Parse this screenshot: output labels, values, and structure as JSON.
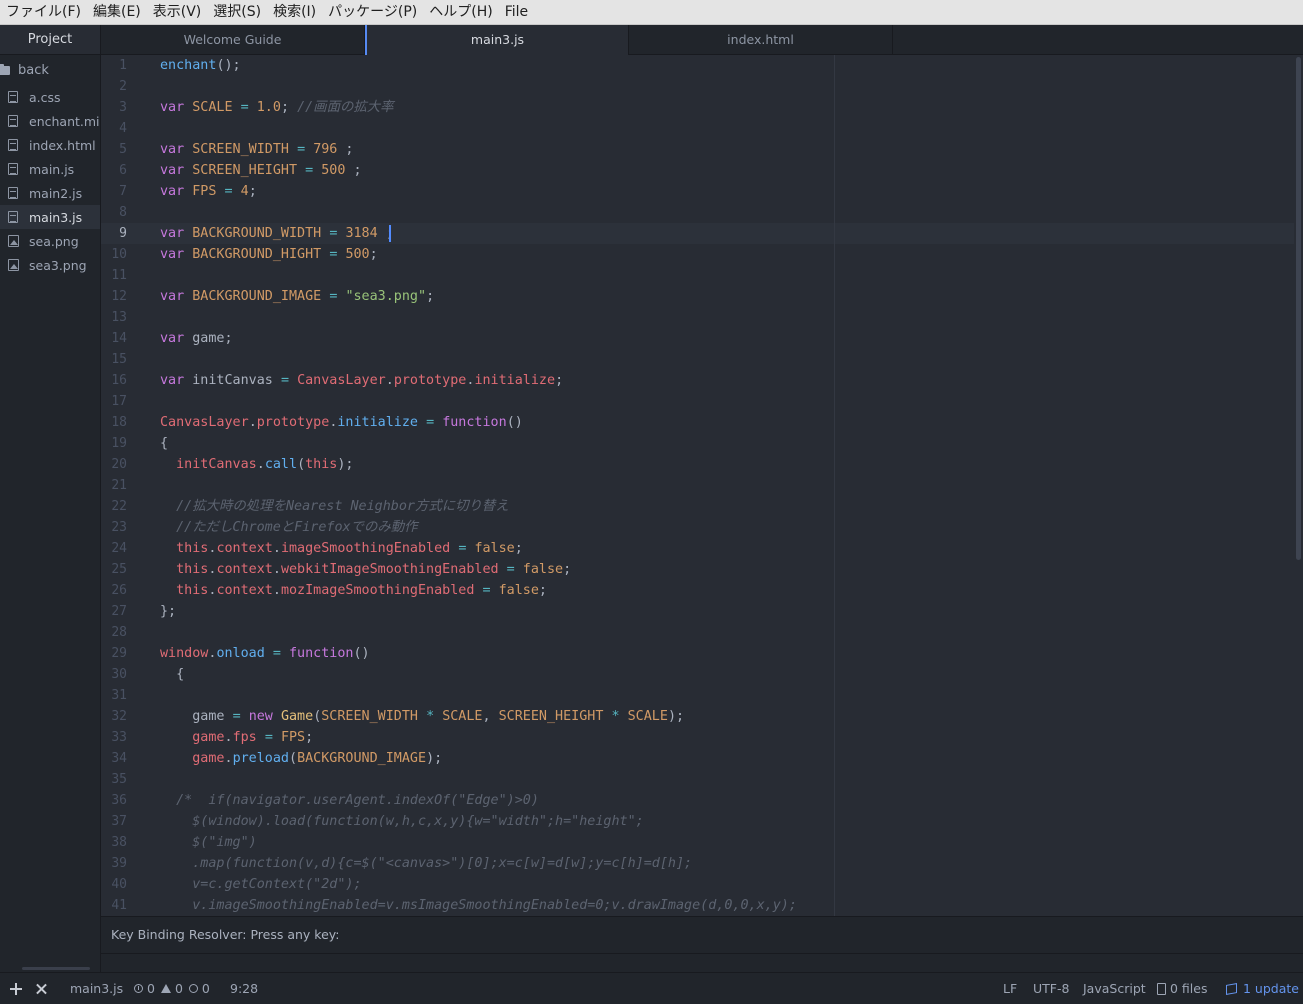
{
  "menubar": {
    "items": [
      "ファイル(F)",
      "編集(E)",
      "表示(V)",
      "選択(S)",
      "検索(I)",
      "パッケージ(P)",
      "ヘルプ(H)",
      "File"
    ]
  },
  "treeview": {
    "tab_label": "Project",
    "root_folder": "back",
    "files": [
      {
        "name": "a.css",
        "type": "file"
      },
      {
        "name": "enchant.min.js",
        "type": "file"
      },
      {
        "name": "index.html",
        "type": "file"
      },
      {
        "name": "main.js",
        "type": "file"
      },
      {
        "name": "main2.js",
        "type": "file"
      },
      {
        "name": "main3.js",
        "type": "file",
        "selected": true
      },
      {
        "name": "sea.png",
        "type": "image"
      },
      {
        "name": "sea3.png",
        "type": "image"
      }
    ]
  },
  "tabs": [
    {
      "label": "Welcome Guide",
      "active": false
    },
    {
      "label": "main3.js",
      "active": true
    },
    {
      "label": "index.html",
      "active": false
    }
  ],
  "editor": {
    "cursor_line": 9,
    "lines": [
      [
        [
          "f",
          "enchant"
        ],
        [
          "p",
          "();"
        ]
      ],
      [],
      [
        [
          "k",
          "var"
        ],
        [
          "p",
          " "
        ],
        [
          "c",
          "SCALE"
        ],
        [
          "p",
          " "
        ],
        [
          "o",
          "="
        ],
        [
          "p",
          " "
        ],
        [
          "n",
          "1.0"
        ],
        [
          "p",
          "; "
        ],
        [
          "cm",
          "//画面の拡大率"
        ]
      ],
      [],
      [
        [
          "k",
          "var"
        ],
        [
          "p",
          " "
        ],
        [
          "c",
          "SCREEN_WIDTH"
        ],
        [
          "p",
          " "
        ],
        [
          "o",
          "="
        ],
        [
          "p",
          " "
        ],
        [
          "n",
          "796"
        ],
        [
          "p",
          " ;"
        ]
      ],
      [
        [
          "k",
          "var"
        ],
        [
          "p",
          " "
        ],
        [
          "c",
          "SCREEN_HEIGHT"
        ],
        [
          "p",
          " "
        ],
        [
          "o",
          "="
        ],
        [
          "p",
          " "
        ],
        [
          "n",
          "500"
        ],
        [
          "p",
          " ;"
        ]
      ],
      [
        [
          "k",
          "var"
        ],
        [
          "p",
          " "
        ],
        [
          "c",
          "FPS"
        ],
        [
          "p",
          " "
        ],
        [
          "o",
          "="
        ],
        [
          "p",
          " "
        ],
        [
          "n",
          "4"
        ],
        [
          "p",
          ";"
        ]
      ],
      [],
      [
        [
          "k",
          "var"
        ],
        [
          "p",
          " "
        ],
        [
          "c",
          "BACKGROUND_WIDTH"
        ],
        [
          "p",
          " "
        ],
        [
          "o",
          "="
        ],
        [
          "p",
          " "
        ],
        [
          "n",
          "3184"
        ],
        [
          "p",
          " ;"
        ]
      ],
      [
        [
          "k",
          "var"
        ],
        [
          "p",
          " "
        ],
        [
          "c",
          "BACKGROUND_HIGHT"
        ],
        [
          "p",
          " "
        ],
        [
          "o",
          "="
        ],
        [
          "p",
          " "
        ],
        [
          "n",
          "500"
        ],
        [
          "p",
          ";"
        ]
      ],
      [],
      [
        [
          "k",
          "var"
        ],
        [
          "p",
          " "
        ],
        [
          "c",
          "BACKGROUND_IMAGE"
        ],
        [
          "p",
          " "
        ],
        [
          "o",
          "="
        ],
        [
          "p",
          " "
        ],
        [
          "s",
          "\"sea3.png\""
        ],
        [
          "p",
          ";"
        ]
      ],
      [],
      [
        [
          "k",
          "var"
        ],
        [
          "p",
          " game;"
        ]
      ],
      [],
      [
        [
          "k",
          "var"
        ],
        [
          "p",
          " initCanvas "
        ],
        [
          "o",
          "="
        ],
        [
          "p",
          " "
        ],
        [
          "v",
          "CanvasLayer"
        ],
        [
          "p",
          "."
        ],
        [
          "v",
          "prototype"
        ],
        [
          "p",
          "."
        ],
        [
          "v",
          "initialize"
        ],
        [
          "p",
          ";"
        ]
      ],
      [],
      [
        [
          "v",
          "CanvasLayer"
        ],
        [
          "p",
          "."
        ],
        [
          "v",
          "prototype"
        ],
        [
          "p",
          "."
        ],
        [
          "f",
          "initialize"
        ],
        [
          "p",
          " "
        ],
        [
          "o",
          "="
        ],
        [
          "p",
          " "
        ],
        [
          "k",
          "function"
        ],
        [
          "p",
          "()"
        ]
      ],
      [
        [
          "p",
          "{"
        ]
      ],
      [
        [
          "p",
          "  "
        ],
        [
          "v",
          "initCanvas"
        ],
        [
          "p",
          "."
        ],
        [
          "f",
          "call"
        ],
        [
          "p",
          "("
        ],
        [
          "v",
          "this"
        ],
        [
          "p",
          ");"
        ]
      ],
      [],
      [
        [
          "p",
          "  "
        ],
        [
          "cm",
          "//拡大時の処理をNearest Neighbor方式に切り替え"
        ]
      ],
      [
        [
          "p",
          "  "
        ],
        [
          "cm",
          "//ただしChromeとFirefoxでのみ動作"
        ]
      ],
      [
        [
          "p",
          "  "
        ],
        [
          "v",
          "this"
        ],
        [
          "p",
          "."
        ],
        [
          "v",
          "context"
        ],
        [
          "p",
          "."
        ],
        [
          "v",
          "imageSmoothingEnabled"
        ],
        [
          "p",
          " "
        ],
        [
          "o",
          "="
        ],
        [
          "p",
          " "
        ],
        [
          "n",
          "false"
        ],
        [
          "p",
          ";"
        ]
      ],
      [
        [
          "p",
          "  "
        ],
        [
          "v",
          "this"
        ],
        [
          "p",
          "."
        ],
        [
          "v",
          "context"
        ],
        [
          "p",
          "."
        ],
        [
          "v",
          "webkitImageSmoothingEnabled"
        ],
        [
          "p",
          " "
        ],
        [
          "o",
          "="
        ],
        [
          "p",
          " "
        ],
        [
          "n",
          "false"
        ],
        [
          "p",
          ";"
        ]
      ],
      [
        [
          "p",
          "  "
        ],
        [
          "v",
          "this"
        ],
        [
          "p",
          "."
        ],
        [
          "v",
          "context"
        ],
        [
          "p",
          "."
        ],
        [
          "v",
          "mozImageSmoothingEnabled"
        ],
        [
          "p",
          " "
        ],
        [
          "o",
          "="
        ],
        [
          "p",
          " "
        ],
        [
          "n",
          "false"
        ],
        [
          "p",
          ";"
        ]
      ],
      [
        [
          "p",
          "};"
        ]
      ],
      [],
      [
        [
          "v",
          "window"
        ],
        [
          "p",
          "."
        ],
        [
          "f",
          "onload"
        ],
        [
          "p",
          " "
        ],
        [
          "o",
          "="
        ],
        [
          "p",
          " "
        ],
        [
          "k",
          "function"
        ],
        [
          "p",
          "()"
        ]
      ],
      [
        [
          "p",
          "  {"
        ]
      ],
      [],
      [
        [
          "p",
          "    game "
        ],
        [
          "o",
          "="
        ],
        [
          "p",
          " "
        ],
        [
          "k",
          "new"
        ],
        [
          "p",
          " "
        ],
        [
          "y",
          "Game"
        ],
        [
          "p",
          "("
        ],
        [
          "c",
          "SCREEN_WIDTH"
        ],
        [
          "p",
          " "
        ],
        [
          "o",
          "*"
        ],
        [
          "p",
          " "
        ],
        [
          "c",
          "SCALE"
        ],
        [
          "p",
          ", "
        ],
        [
          "c",
          "SCREEN_HEIGHT"
        ],
        [
          "p",
          " "
        ],
        [
          "o",
          "*"
        ],
        [
          "p",
          " "
        ],
        [
          "c",
          "SCALE"
        ],
        [
          "p",
          ");"
        ]
      ],
      [
        [
          "p",
          "    "
        ],
        [
          "v",
          "game"
        ],
        [
          "p",
          "."
        ],
        [
          "v",
          "fps"
        ],
        [
          "p",
          " "
        ],
        [
          "o",
          "="
        ],
        [
          "p",
          " "
        ],
        [
          "c",
          "FPS"
        ],
        [
          "p",
          ";"
        ]
      ],
      [
        [
          "p",
          "    "
        ],
        [
          "v",
          "game"
        ],
        [
          "p",
          "."
        ],
        [
          "f",
          "preload"
        ],
        [
          "p",
          "("
        ],
        [
          "c",
          "BACKGROUND_IMAGE"
        ],
        [
          "p",
          ");"
        ]
      ],
      [],
      [
        [
          "p",
          "  "
        ],
        [
          "cm",
          "/*  if(navigator.userAgent.indexOf(\"Edge\")>0)"
        ]
      ],
      [
        [
          "p",
          "    "
        ],
        [
          "cm",
          "$(window).load(function(w,h,c,x,y){w=\"width\";h=\"height\";"
        ]
      ],
      [
        [
          "p",
          "    "
        ],
        [
          "cm",
          "$(\"img\")"
        ]
      ],
      [
        [
          "p",
          "    "
        ],
        [
          "cm",
          ".map(function(v,d){c=$(\"<canvas>\")[0];x=c[w]=d[w];y=c[h]=d[h];"
        ]
      ],
      [
        [
          "p",
          "    "
        ],
        [
          "cm",
          "v=c.getContext(\"2d\");"
        ]
      ],
      [
        [
          "p",
          "    "
        ],
        [
          "cm",
          "v.imageSmoothingEnabled=v.msImageSmoothingEnabled=0;v.drawImage(d,0,0,x,y);"
        ]
      ]
    ]
  },
  "keybinding_resolver": {
    "text": "Key Binding Resolver: Press any key:"
  },
  "statusbar": {
    "file_name": "main3.js",
    "errors": "0",
    "warnings": "0",
    "infos": "0",
    "cursor_position": "9:28",
    "line_ending": "LF",
    "encoding": "UTF-8",
    "grammar": "JavaScript",
    "git_files": "0 files",
    "updates": "1 update"
  },
  "colors": {
    "accent": "#568af2",
    "background": "#282c34",
    "update_link": "#6494ed"
  }
}
